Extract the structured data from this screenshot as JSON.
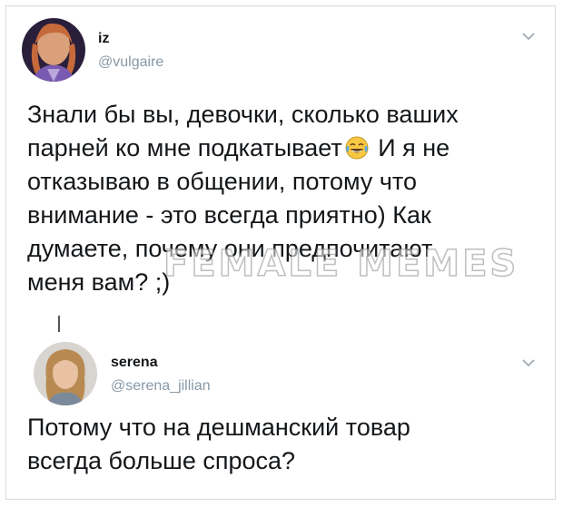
{
  "tweets": [
    {
      "name": "iz",
      "handle": "@vulgaire",
      "text_before_emoji": "Знали бы вы, девочки, сколько ваших\nпарней ко мне подкатывает",
      "emoji": "face-with-tears-of-joy",
      "text_after_emoji": " И я не\nотказываю в общении, потому что\nвнимание - это всегда приятно) Как\nдумаете, почему они предпочитают\nменя вам? ;)"
    },
    {
      "name": "serena",
      "handle": "@serena_jillian",
      "text": "Потому что на дешманский товар\nвсегда больше спроса?"
    }
  ],
  "watermark": "FEMALE MEMES",
  "colors": {
    "text": "#14171a",
    "handle": "#8899a6",
    "border": "#d9d9d9"
  }
}
